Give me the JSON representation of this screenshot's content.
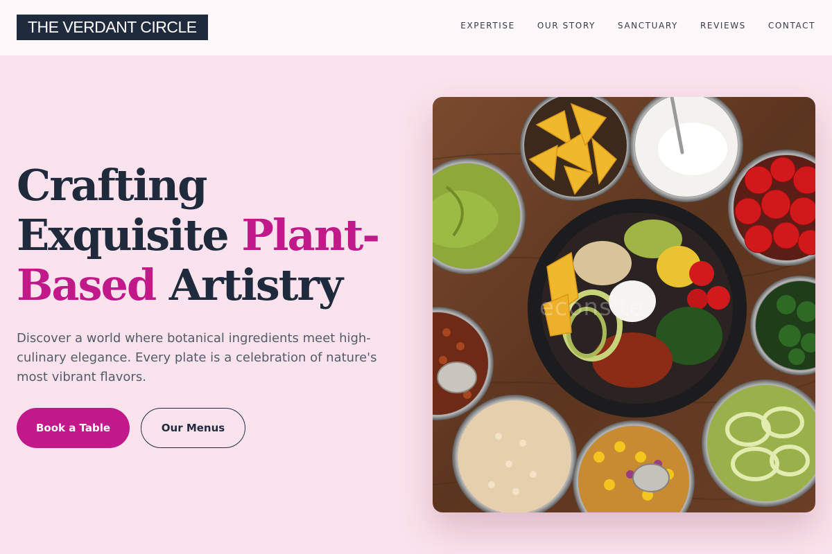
{
  "header": {
    "logo": "THE VERDANT CIRCLE",
    "nav": [
      "EXPERTISE",
      "OUR STORY",
      "SANCTUARY",
      "REVIEWS",
      "CONTACT"
    ]
  },
  "hero": {
    "title_line1": "Crafting",
    "title_line2_a": "Exquisite ",
    "title_line2_b": "Plant-",
    "title_line3_a": "Based",
    "title_line3_b": " Artistry",
    "description": "Discover a world where botanical ingredients meet high-culinary elegance. Every plate is a celebration of nature's most vibrant flavors.",
    "primary_button": "Book a Table",
    "secondary_button": "Our Menus"
  },
  "image": {
    "watermark": "econsite"
  },
  "colors": {
    "accent": "#c2198a",
    "navy": "#1f2a3d",
    "background": "#fae3ec"
  }
}
